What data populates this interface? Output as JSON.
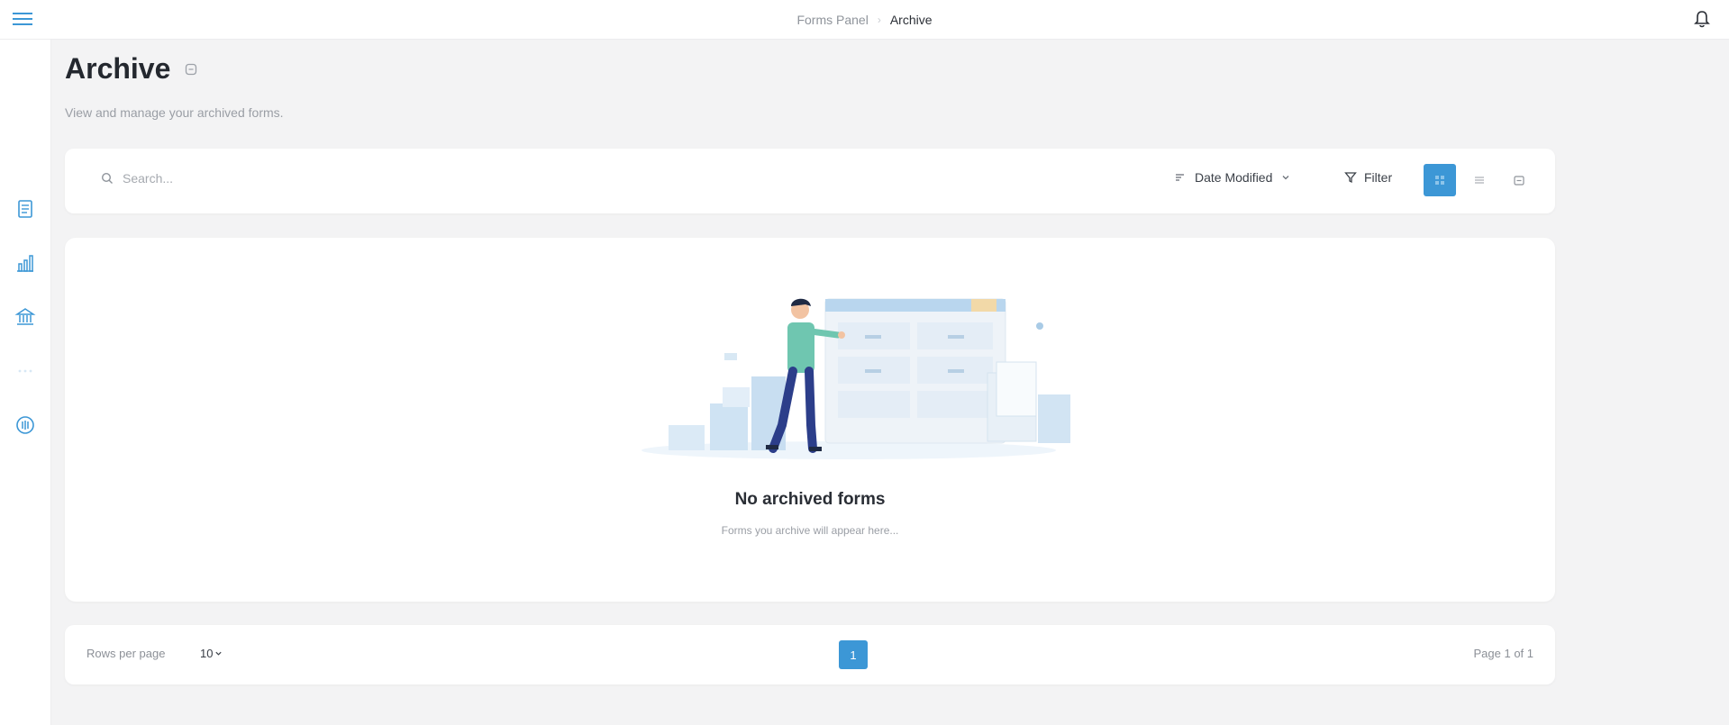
{
  "header": {
    "menu_icon": "hamburger-icon",
    "breadcrumb": {
      "parent": "Forms Panel",
      "current": "Archive"
    },
    "notification_icon": "bell-icon"
  },
  "sidebar": {
    "items": [
      {
        "icon": "document-icon"
      },
      {
        "icon": "bar-chart-icon"
      },
      {
        "icon": "bank-icon"
      },
      {
        "icon": "dots-icon"
      },
      {
        "icon": "circle-grid-icon"
      }
    ]
  },
  "page": {
    "title": "Archive",
    "subtitle": "View and manage your archived forms."
  },
  "toolbar": {
    "search_placeholder": "Search...",
    "sort_label": "Date Modified",
    "filter_label": "Filter"
  },
  "empty_state": {
    "title": "No archived forms",
    "subtitle": "Forms you archive will appear here..."
  },
  "pagination": {
    "rows_label": "Rows per page",
    "rows_value": "10",
    "current_page": "1",
    "page_info": "Page 1 of 1"
  },
  "colors": {
    "accent": "#3c97d6",
    "background": "#f3f3f4",
    "card": "#ffffff"
  }
}
